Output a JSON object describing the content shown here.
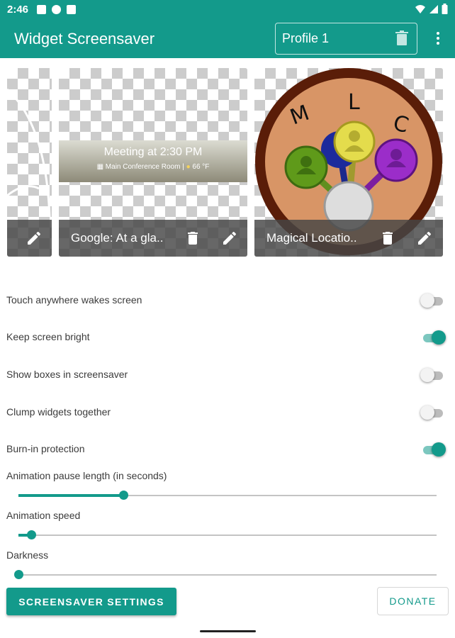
{
  "status_bar": {
    "time": "2:46",
    "icons": [
      "gmail-icon",
      "headset-icon",
      "sd-card-icon",
      "wifi-icon",
      "signal-icon",
      "battery-icon"
    ]
  },
  "app_bar": {
    "title": "Widget Screensaver",
    "profile": "Profile 1"
  },
  "widgets": [
    {
      "id": "partial",
      "name": ""
    },
    {
      "id": "google",
      "name": "Google: At a gla..",
      "meeting_title": "Meeting at 2:30 PM",
      "meeting_place": "Main Conference Room",
      "meeting_temp": "66 °F"
    },
    {
      "id": "mlc",
      "name": "Magical Locatio..",
      "letters": [
        "M",
        "L",
        "C"
      ]
    }
  ],
  "settings": {
    "toggles": [
      {
        "label": "Touch anywhere wakes screen",
        "on": false
      },
      {
        "label": "Keep screen bright",
        "on": true
      },
      {
        "label": "Show boxes in screensaver",
        "on": false
      },
      {
        "label": "Clump widgets together",
        "on": false
      },
      {
        "label": "Burn-in protection",
        "on": true
      }
    ],
    "sliders": [
      {
        "label": "Animation pause length (in seconds)",
        "value": 0.25
      },
      {
        "label": "Animation speed",
        "value": 0.03
      },
      {
        "label": "Darkness",
        "value": 0.0
      }
    ]
  },
  "buttons": {
    "screensaver_settings": "SCREENSAVER SETTINGS",
    "donate": "DONATE"
  },
  "colors": {
    "accent": "#139a8b",
    "accent_light": "#7cc7bf"
  }
}
